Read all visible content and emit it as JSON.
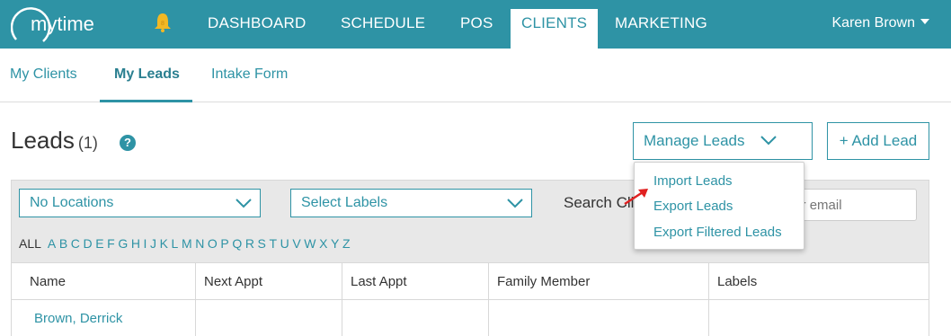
{
  "topnav": {
    "logo_text": "mytime",
    "items": [
      {
        "label": "DASHBOARD"
      },
      {
        "label": "SCHEDULE"
      },
      {
        "label": "POS"
      },
      {
        "label": "CLIENTS"
      },
      {
        "label": "MARKETING"
      }
    ],
    "user": "Karen Brown",
    "brand_color": "#2E93A5",
    "bell_color": "#F2B824"
  },
  "subnav": {
    "tabs": [
      {
        "label": "My Clients"
      },
      {
        "label": "My Leads"
      },
      {
        "label": "Intake Form"
      }
    ]
  },
  "header": {
    "title": "Leads",
    "count": "(1)",
    "help": "?",
    "manage_label": "Manage Leads",
    "add_label": "+ Add Lead"
  },
  "filters": {
    "locations": "No Locations",
    "labels": "Select Labels",
    "search_label": "Search Cli",
    "search_placeholder": "per, or email",
    "alpha_all": "ALL",
    "letters": [
      "A",
      "B",
      "C",
      "D",
      "E",
      "F",
      "G",
      "H",
      "I",
      "J",
      "K",
      "L",
      "M",
      "N",
      "O",
      "P",
      "Q",
      "R",
      "S",
      "T",
      "U",
      "V",
      "W",
      "X",
      "Y",
      "Z"
    ]
  },
  "table": {
    "columns": [
      "Name",
      "Next Appt",
      "Last Appt",
      "Family Member",
      "Labels"
    ],
    "rows": [
      {
        "name": "Brown, Derrick"
      }
    ]
  },
  "menu": {
    "items": [
      "Import Leads",
      "Export Leads",
      "Export Filtered Leads"
    ]
  }
}
